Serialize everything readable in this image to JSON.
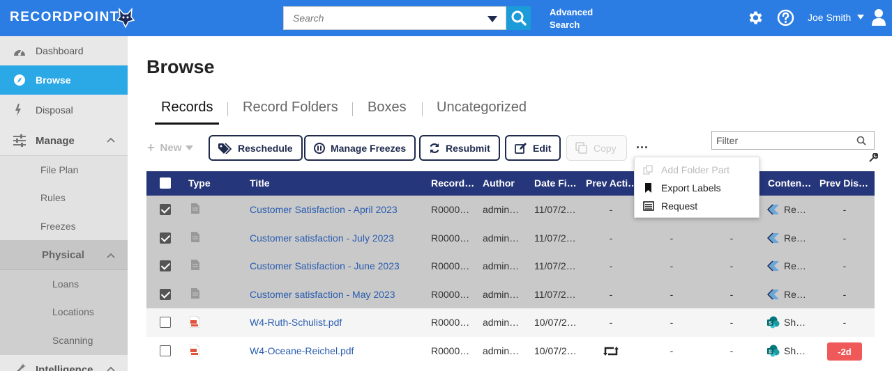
{
  "app": {
    "logo_text": "RECORDPOINT",
    "search_placeholder": "Search",
    "advanced_search_label": "Advanced Search",
    "user_name": "Joe Smith"
  },
  "sidebar": {
    "items": [
      {
        "label": "Dashboard",
        "icon": "dashboard-icon"
      },
      {
        "label": "Browse",
        "icon": "compass-icon",
        "active": true
      },
      {
        "label": "Disposal",
        "icon": "bolt-icon"
      },
      {
        "label": "Manage",
        "icon": "sliders-icon"
      }
    ],
    "manage_sub": [
      "File Plan",
      "Rules",
      "Freezes"
    ],
    "physical_label": "Physical",
    "physical_sub": [
      "Loans",
      "Locations",
      "Scanning"
    ],
    "intelligence_label": "Intelligence"
  },
  "main": {
    "title": "Browse",
    "tabs": [
      "Records",
      "Record Folders",
      "Boxes",
      "Uncategorized"
    ],
    "active_tab": "Records"
  },
  "toolbar": {
    "new_label": "New",
    "reschedule_label": "Reschedule",
    "manage_freezes_label": "Manage Freezes",
    "resubmit_label": "Resubmit",
    "edit_label": "Edit",
    "copy_label": "Copy",
    "more_label": "···",
    "filter_placeholder": "Filter"
  },
  "dropdown": {
    "items": [
      {
        "label": "Add Folder Part",
        "disabled": true
      },
      {
        "label": "Export Labels",
        "disabled": false
      },
      {
        "label": "Request",
        "disabled": false
      }
    ]
  },
  "table": {
    "headers": [
      "Type",
      "Title",
      "Record…",
      "Author",
      "Date Fi…",
      "Prev Acti…",
      "Conten…",
      "Prev Dis…"
    ],
    "rows": [
      {
        "checked": true,
        "type": "document",
        "title": "Customer Satisfaction - April 2023",
        "record": "R0000…",
        "author": "admin…",
        "date": "11/07/2…",
        "prev_action": "-",
        "col7": "",
        "col8": "",
        "content": "Re…",
        "content_source": "record-icon",
        "prev_dis": "-"
      },
      {
        "checked": true,
        "type": "document",
        "title": "Customer satisfaction - July 2023",
        "record": "R0000…",
        "author": "admin…",
        "date": "11/07/2…",
        "prev_action": "-",
        "col7": "-",
        "col8": "-",
        "content": "Re…",
        "content_source": "record-icon",
        "prev_dis": "-"
      },
      {
        "checked": true,
        "type": "document",
        "title": "Customer Satisfaction - June 2023",
        "record": "R0000…",
        "author": "admin…",
        "date": "11/07/2…",
        "prev_action": "-",
        "col7": "-",
        "col8": "-",
        "content": "Re…",
        "content_source": "record-icon",
        "prev_dis": "-"
      },
      {
        "checked": true,
        "type": "document",
        "title": "Customer satisfaction - May 2023",
        "record": "R0000…",
        "author": "admin…",
        "date": "11/07/2…",
        "prev_action": "-",
        "col7": "-",
        "col8": "-",
        "content": "Re…",
        "content_source": "record-icon",
        "prev_dis": "-"
      },
      {
        "checked": false,
        "type": "pdf",
        "title": "W4-Ruth-Schulist.pdf",
        "record": "R0000…",
        "author": "admin…",
        "date": "10/07/2…",
        "prev_action": "-",
        "col7": "-",
        "col8": "-",
        "content": "Sh…",
        "content_source": "sharepoint-icon",
        "prev_dis": "-"
      },
      {
        "checked": false,
        "type": "pdf",
        "title": "W4-Oceane-Reichel.pdf",
        "record": "R0000…",
        "author": "admin…",
        "date": "10/07/2…",
        "prev_action": "",
        "prev_action_icon": "retweet-icon",
        "col7": "-",
        "col8": "-",
        "content": "Sh…",
        "content_source": "sharepoint-icon",
        "prev_dis": "-2d"
      }
    ]
  }
}
